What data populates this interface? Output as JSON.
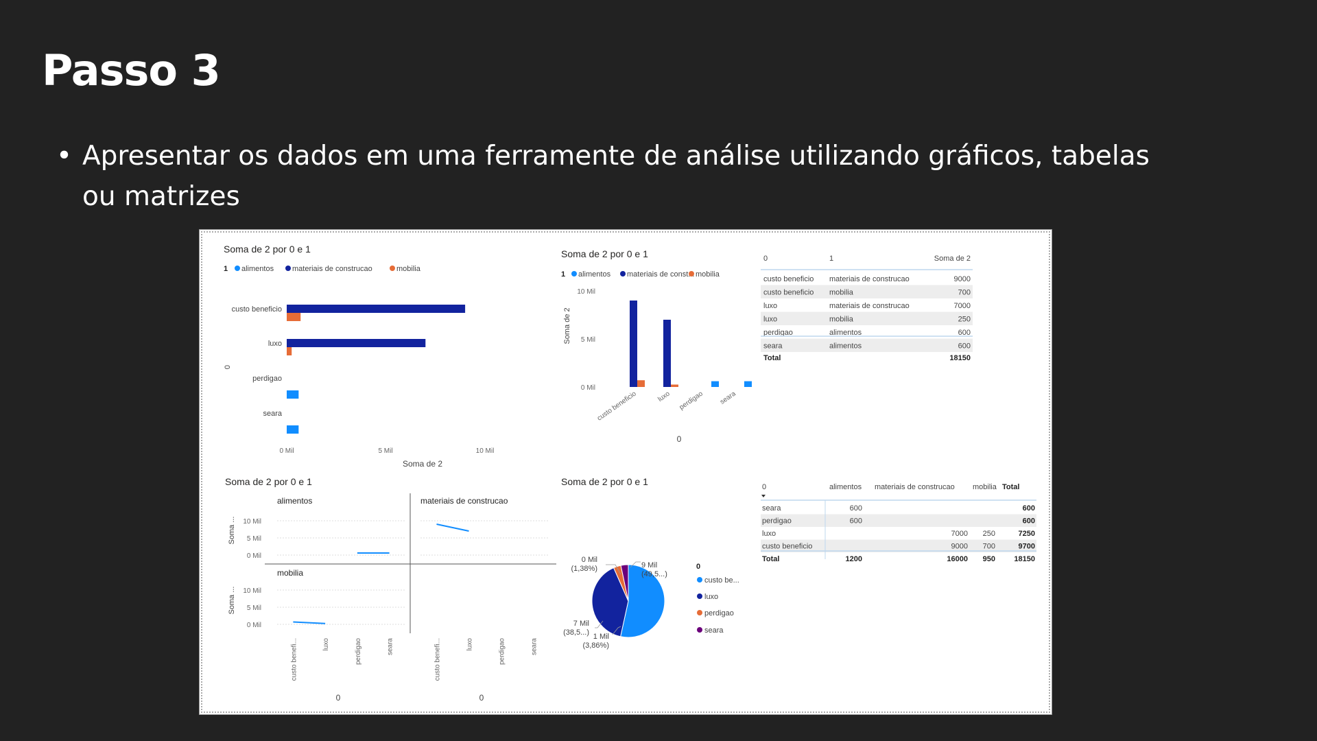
{
  "slide": {
    "title": "Passo 3",
    "bullet": "•",
    "text_line1": "Apresentar os dados em uma ferramente de análise utilizando gráficos, tabelas",
    "text_line2": "ou matrizes"
  },
  "colors": {
    "alimentos": "#118DFF",
    "materiais": "#12239E",
    "mobilia": "#E66C37",
    "seara": "#6B007B"
  },
  "visual_bar_h": {
    "title": "Soma de 2 por 0 e 1",
    "legend_title": "1",
    "legend": [
      "alimentos",
      "materiais de construcao",
      "mobilia"
    ],
    "categories": [
      "custo beneficio",
      "luxo",
      "perdigao",
      "seara"
    ],
    "y_axis_title": "0",
    "x_axis_title": "Soma de 2",
    "x_ticks": [
      "0 Mil",
      "5 Mil",
      "10 Mil"
    ]
  },
  "visual_bar_v": {
    "title": "Soma de 2 por 0 e 1",
    "legend_title": "1",
    "legend": [
      "alimentos",
      "materiais de const...",
      "mobilia"
    ],
    "y_ticks": [
      "10 Mil",
      "5 Mil",
      "0 Mil"
    ],
    "y_axis_title": "Soma de 2",
    "categories": [
      "custo beneficio",
      "luxo",
      "perdigao",
      "seara"
    ],
    "x_axis_title": "0"
  },
  "visual_table": {
    "headers": [
      "0",
      "1",
      "Soma de 2"
    ],
    "rows": [
      [
        "custo beneficio",
        "materiais de construcao",
        "9000"
      ],
      [
        "custo beneficio",
        "mobilia",
        "700"
      ],
      [
        "luxo",
        "materiais de construcao",
        "7000"
      ],
      [
        "luxo",
        "mobilia",
        "250"
      ],
      [
        "perdigao",
        "alimentos",
        "600"
      ],
      [
        "seara",
        "alimentos",
        "600"
      ]
    ],
    "total_label": "Total",
    "total_value": "18150"
  },
  "visual_small_multiples": {
    "title": "Soma de 2 por 0 e 1",
    "panels": [
      "alimentos",
      "materiais de construcao",
      "mobilia"
    ],
    "y_axis_title": "Soma ...",
    "y_ticks": [
      "10 Mil",
      "5 Mil",
      "0 Mil"
    ],
    "x_labels": [
      "custo benefi...",
      "luxo",
      "perdigao",
      "seara"
    ],
    "x_axis_title": "0"
  },
  "visual_pie": {
    "title": "Soma de 2 por 0 e 1",
    "legend_title": "0",
    "legend": [
      "custo be...",
      "luxo",
      "perdigao",
      "seara"
    ],
    "labels": {
      "top_left_value": "0 Mil",
      "top_left_pct": "(1,38%)",
      "right_value": "9 Mil",
      "right_pct": "(49,5...)",
      "left_value": "7 Mil",
      "left_pct": "(38,5...)",
      "bottom_value": "1 Mil",
      "bottom_pct": "(3,86%)"
    }
  },
  "visual_matrix": {
    "headers": [
      "0",
      "alimentos",
      "materiais de construcao",
      "mobilia",
      "Total"
    ],
    "rows": [
      [
        "seara",
        "600",
        "",
        "",
        "600"
      ],
      [
        "perdigao",
        "600",
        "",
        "",
        "600"
      ],
      [
        "luxo",
        "",
        "7000",
        "250",
        "7250"
      ],
      [
        "custo beneficio",
        "",
        "9000",
        "700",
        "9700"
      ]
    ],
    "total_row": [
      "Total",
      "1200",
      "16000",
      "950",
      "18150"
    ]
  },
  "chart_data": [
    {
      "type": "bar",
      "orientation": "horizontal",
      "title": "Soma de 2 por 0 e 1",
      "categories": [
        "custo beneficio",
        "luxo",
        "perdigao",
        "seara"
      ],
      "series": [
        {
          "name": "alimentos",
          "values": [
            0,
            0,
            600,
            600
          ]
        },
        {
          "name": "materiais de construcao",
          "values": [
            9000,
            7000,
            0,
            0
          ]
        },
        {
          "name": "mobilia",
          "values": [
            700,
            250,
            0,
            0
          ]
        }
      ],
      "xlabel": "Soma de 2",
      "ylabel": "0",
      "xlim": [
        0,
        10000
      ]
    },
    {
      "type": "bar",
      "orientation": "vertical",
      "title": "Soma de 2 por 0 e 1",
      "categories": [
        "custo beneficio",
        "luxo",
        "perdigao",
        "seara"
      ],
      "series": [
        {
          "name": "alimentos",
          "values": [
            0,
            0,
            600,
            600
          ]
        },
        {
          "name": "materiais de construcao",
          "values": [
            9000,
            7000,
            0,
            0
          ]
        },
        {
          "name": "mobilia",
          "values": [
            700,
            250,
            0,
            0
          ]
        }
      ],
      "xlabel": "0",
      "ylabel": "Soma de 2",
      "ylim": [
        0,
        10000
      ]
    },
    {
      "type": "line",
      "title": "Soma de 2 por 0 e 1",
      "categories": [
        "custo beneficio",
        "luxo",
        "perdigao",
        "seara"
      ],
      "series": [
        {
          "name": "alimentos",
          "values": [
            null,
            null,
            600,
            600
          ]
        },
        {
          "name": "materiais de construcao",
          "values": [
            9000,
            7000,
            null,
            null
          ]
        },
        {
          "name": "mobilia",
          "values": [
            700,
            250,
            null,
            null
          ]
        }
      ],
      "ylim": [
        0,
        10000
      ]
    },
    {
      "type": "pie",
      "title": "Soma de 2 por 0 e 1",
      "categories": [
        "custo beneficio",
        "luxo",
        "perdigao",
        "seara"
      ],
      "values": [
        9700,
        7250,
        600,
        600
      ]
    }
  ]
}
